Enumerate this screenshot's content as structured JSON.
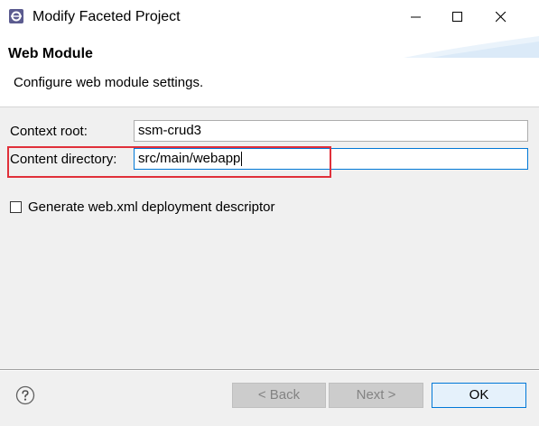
{
  "window": {
    "title": "Modify Faceted Project"
  },
  "banner": {
    "title": "Web Module",
    "description": "Configure web module settings."
  },
  "form": {
    "context_root_label": "Context root:",
    "context_root_value": "ssm-crud3",
    "content_directory_label": "Content directory:",
    "content_directory_value": "src/main/webapp",
    "generate_descriptor_label": "Generate web.xml deployment descriptor",
    "generate_descriptor_checked": false
  },
  "buttons": {
    "back": "< Back",
    "next": "Next >",
    "ok": "OK"
  },
  "colors": {
    "highlight": "#e0303a",
    "focus_border": "#0078d7"
  },
  "icons": {
    "app": "eclipse-icon",
    "help": "help-icon",
    "minimize": "minimize-icon",
    "maximize": "maximize-icon",
    "close": "close-icon"
  }
}
